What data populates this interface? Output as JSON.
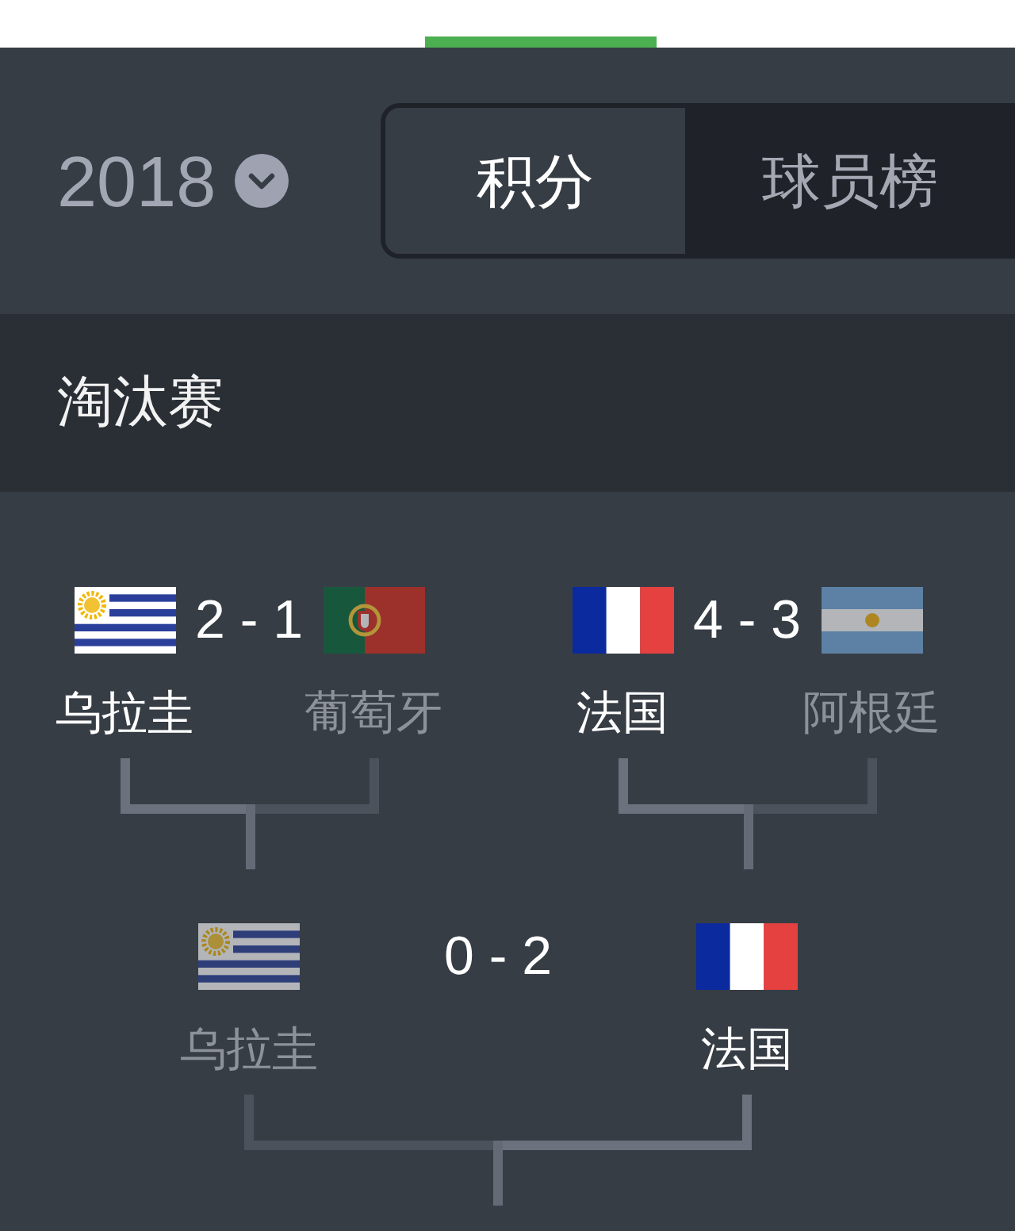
{
  "year": "2018",
  "tabs": [
    {
      "label": "积分",
      "selected": true
    },
    {
      "label": "球员榜",
      "selected": false
    }
  ],
  "section": {
    "title": "淘汰赛"
  },
  "rounds": [
    {
      "matches": [
        {
          "score": "2 - 1",
          "teams": [
            {
              "name": "乌拉圭",
              "kind": "uruguay",
              "winner": true
            },
            {
              "name": "葡萄牙",
              "kind": "portugal",
              "winner": false
            }
          ]
        },
        {
          "score": "4 - 3",
          "teams": [
            {
              "name": "法国",
              "kind": "france",
              "winner": true
            },
            {
              "name": "阿根廷",
              "kind": "argentina",
              "winner": false
            }
          ]
        }
      ]
    },
    {
      "matches": [
        {
          "score": "0 - 2",
          "teams": [
            {
              "name": "乌拉圭",
              "kind": "uruguay",
              "winner": false
            },
            {
              "name": "法国",
              "kind": "france",
              "winner": true
            }
          ]
        }
      ]
    }
  ]
}
